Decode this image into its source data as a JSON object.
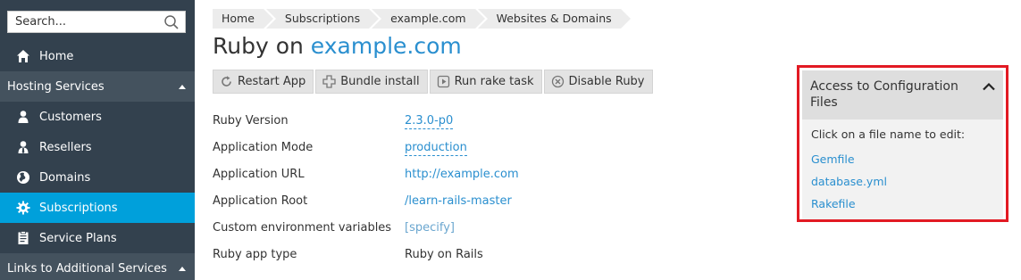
{
  "sidebar": {
    "search_placeholder": "Search...",
    "items": [
      {
        "label": "Home",
        "icon": "home-icon"
      },
      {
        "label": "Customers",
        "icon": "user-icon"
      },
      {
        "label": "Resellers",
        "icon": "reseller-icon"
      },
      {
        "label": "Domains",
        "icon": "globe-icon"
      },
      {
        "label": "Subscriptions",
        "icon": "gear-icon"
      },
      {
        "label": "Service Plans",
        "icon": "plan-icon"
      }
    ],
    "groups": [
      {
        "label": "Hosting Services"
      },
      {
        "label": "Links to Additional Services"
      }
    ],
    "active_item": "Subscriptions",
    "active_color": "#00a0db",
    "bg_color": "#33414e"
  },
  "breadcrumb": [
    "Home",
    "Subscriptions",
    "example.com",
    "Websites & Domains"
  ],
  "title": {
    "prefix": "Ruby on",
    "domain": "example.com"
  },
  "toolbar": [
    {
      "label": "Restart App",
      "icon": "restart-icon"
    },
    {
      "label": "Bundle install",
      "icon": "bundle-icon"
    },
    {
      "label": "Run rake task",
      "icon": "run-icon"
    },
    {
      "label": "Disable Ruby",
      "icon": "disable-icon"
    }
  ],
  "properties": [
    {
      "label": "Ruby Version",
      "value": "2.3.0-p0"
    },
    {
      "label": "Application Mode",
      "value": "production"
    },
    {
      "label": "Application URL",
      "value": "http://example.com"
    },
    {
      "label": "Application Root",
      "value": "/learn-rails-master"
    },
    {
      "label": "Custom environment variables",
      "value": "[specify]"
    },
    {
      "label": "Ruby app type",
      "value": "Ruby on Rails"
    }
  ],
  "config_panel": {
    "title": "Access to Configuration Files",
    "hint": "Click on a file name to edit:",
    "files": [
      "Gemfile",
      "database.yml",
      "Rakefile"
    ],
    "highlight_color": "#e21a23"
  },
  "colors": {
    "link": "#2a8fcf"
  }
}
